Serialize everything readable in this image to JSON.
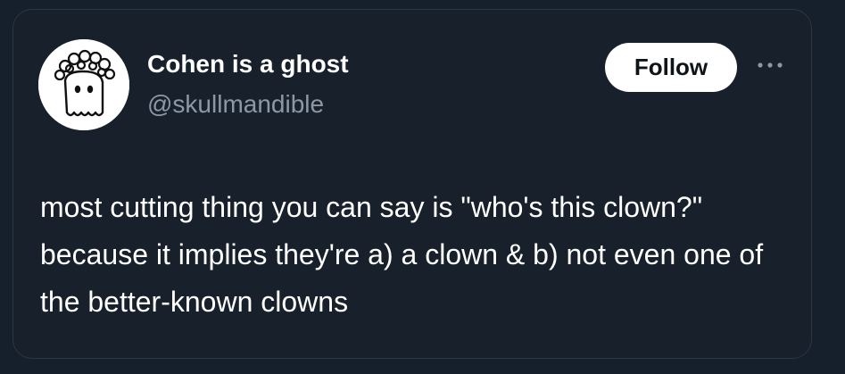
{
  "author": {
    "display_name": "Cohen is a ghost",
    "handle": "@skullmandible",
    "avatar_icon": "ghost-avatar-icon"
  },
  "actions": {
    "follow_label": "Follow",
    "more_icon": "more-options-icon"
  },
  "tweet": {
    "text": "most cutting thing you can say is \"who's this clown?\" because it implies they're a) a clown & b) not even one of the better-known clowns"
  },
  "colors": {
    "background": "#16202c",
    "text_primary": "#ffffff",
    "text_secondary": "#8b98a5",
    "follow_button_bg": "#ffffff",
    "follow_button_text": "#0f1419"
  }
}
